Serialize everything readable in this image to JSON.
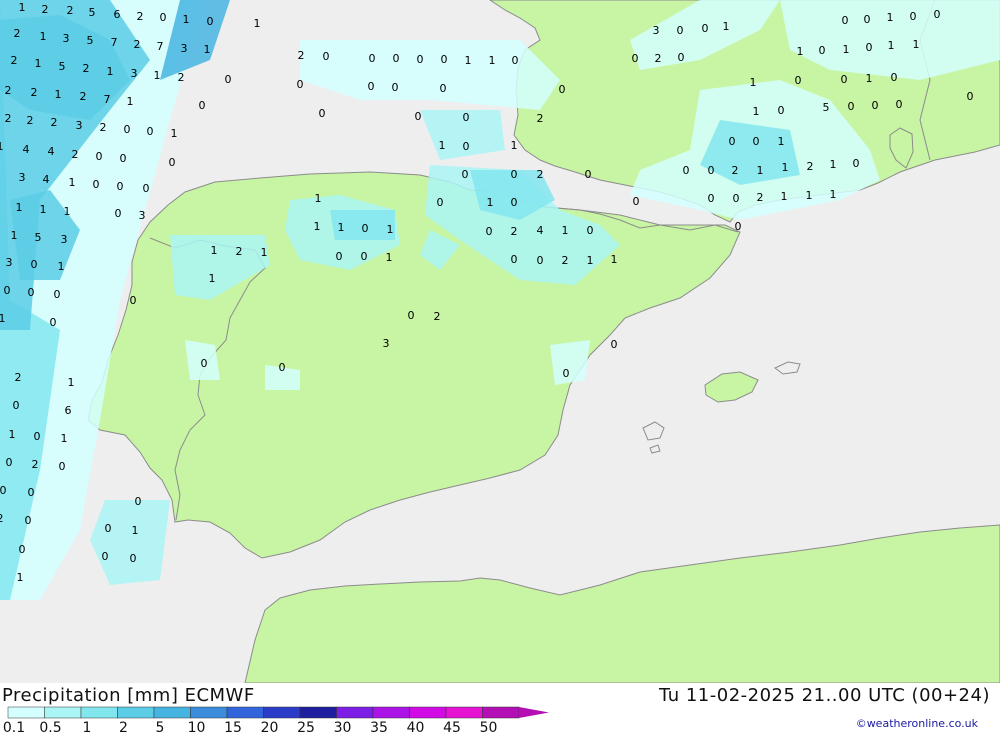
{
  "header": {
    "title": "Precipitation [mm] ECMWF",
    "datetime": "Tu 11-02-2025 21..00 UTC (00+24)",
    "credit": "©weatheronline.co.uk"
  },
  "colors": {
    "sea": "#eeeeee",
    "land": "#c8f5a3",
    "coast": "#8c8c8c"
  },
  "legend": {
    "labels": [
      "0.1",
      "0.5",
      "1",
      "2",
      "5",
      "10",
      "15",
      "20",
      "25",
      "30",
      "35",
      "40",
      "45",
      "50"
    ],
    "colors": [
      "#d4ffff",
      "#aaf5f5",
      "#82e6ef",
      "#5ccde6",
      "#46b4e1",
      "#3c8cdc",
      "#3264dc",
      "#2a3cc8",
      "#1e1ea0",
      "#7d1ee6",
      "#aa14e6",
      "#d20ae6",
      "#e614d2",
      "#b40fb4"
    ]
  },
  "values": [
    "1",
    "2",
    "2",
    "5",
    "6",
    "2",
    "0",
    "1",
    "0",
    "1",
    "2",
    "1",
    "3",
    "5",
    "7",
    "2",
    "7",
    "3",
    "1",
    "2",
    "1",
    "5",
    "2",
    "1",
    "3",
    "1",
    "2",
    "0",
    "2",
    "2",
    "1",
    "2",
    "7",
    "1",
    "0",
    "2",
    "2",
    "2",
    "3",
    "2",
    "0",
    "0",
    "1",
    "1",
    "4",
    "4",
    "2",
    "0",
    "0",
    "0",
    "3",
    "4",
    "1",
    "0",
    "0",
    "0",
    "1",
    "1",
    "1",
    "0",
    "3",
    "1",
    "5",
    "3",
    "1",
    "2",
    "1",
    "3",
    "0",
    "1",
    "1",
    "0",
    "0",
    "0",
    "0",
    "1",
    "0",
    "2",
    "1",
    "0",
    "6",
    "1",
    "0",
    "1",
    "0",
    "2",
    "0",
    "0",
    "0",
    "0",
    "2",
    "0",
    "0",
    "1",
    "0",
    "0",
    "0",
    "1",
    "1",
    "1",
    "1",
    "0",
    "1",
    "0",
    "0",
    "1",
    "0",
    "0",
    "1",
    "0",
    "0",
    "2",
    "0",
    "2",
    "4",
    "1",
    "0",
    "0",
    "0",
    "2",
    "1",
    "1",
    "0",
    "2",
    "3",
    "0",
    "0",
    "0",
    "0",
    "2",
    "0",
    "0",
    "0",
    "0",
    "0",
    "1",
    "1",
    "0",
    "0",
    "0",
    "0",
    "0",
    "0",
    "0",
    "0",
    "2",
    "1",
    "0",
    "1",
    "0",
    "0",
    "0",
    "0",
    "0",
    "2",
    "1",
    "1",
    "2",
    "1",
    "0",
    "0",
    "0",
    "2",
    "1",
    "1",
    "1",
    "0",
    "0",
    "0",
    "1",
    "1",
    "0",
    "5",
    "0",
    "0",
    "0",
    "1",
    "0",
    "0",
    "1",
    "0",
    "0",
    "3",
    "0",
    "0",
    "1",
    "1",
    "0",
    "1",
    "0",
    "1",
    "1",
    "0",
    "2",
    "0",
    "0",
    "0",
    "1",
    "0",
    "0"
  ]
}
